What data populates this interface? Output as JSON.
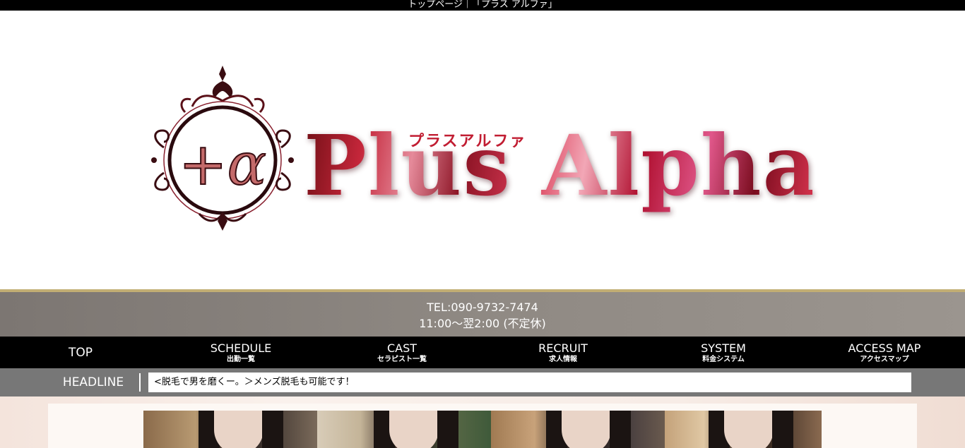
{
  "page_title": "トップページ｜「プラス アルファ」",
  "logo": {
    "title": "Plus Alpha",
    "kana": "プラスアルファ",
    "emblem_text": "+α"
  },
  "info": {
    "tel": "TEL:090-9732-7474",
    "hours": "11:00～翌2:00 (不定休)"
  },
  "nav": [
    {
      "en": "TOP",
      "ja": ""
    },
    {
      "en": "SCHEDULE",
      "ja": "出勤一覧"
    },
    {
      "en": "CAST",
      "ja": "セラピスト一覧"
    },
    {
      "en": "RECRUIT",
      "ja": "求人情報"
    },
    {
      "en": "SYSTEM",
      "ja": "料金システム"
    },
    {
      "en": "ACCESS MAP",
      "ja": "アクセスマップ"
    }
  ],
  "headline": {
    "label": "HEADLINE",
    "text": "<脱毛で男を磨くー。＞メンズ脱毛も可能です！"
  },
  "colors": {
    "nav_bg": "#000000",
    "info_band": "#8f8983",
    "gold_line": "#c2ae74",
    "headline_bg": "#777777",
    "logo_red": "#b3172b"
  }
}
